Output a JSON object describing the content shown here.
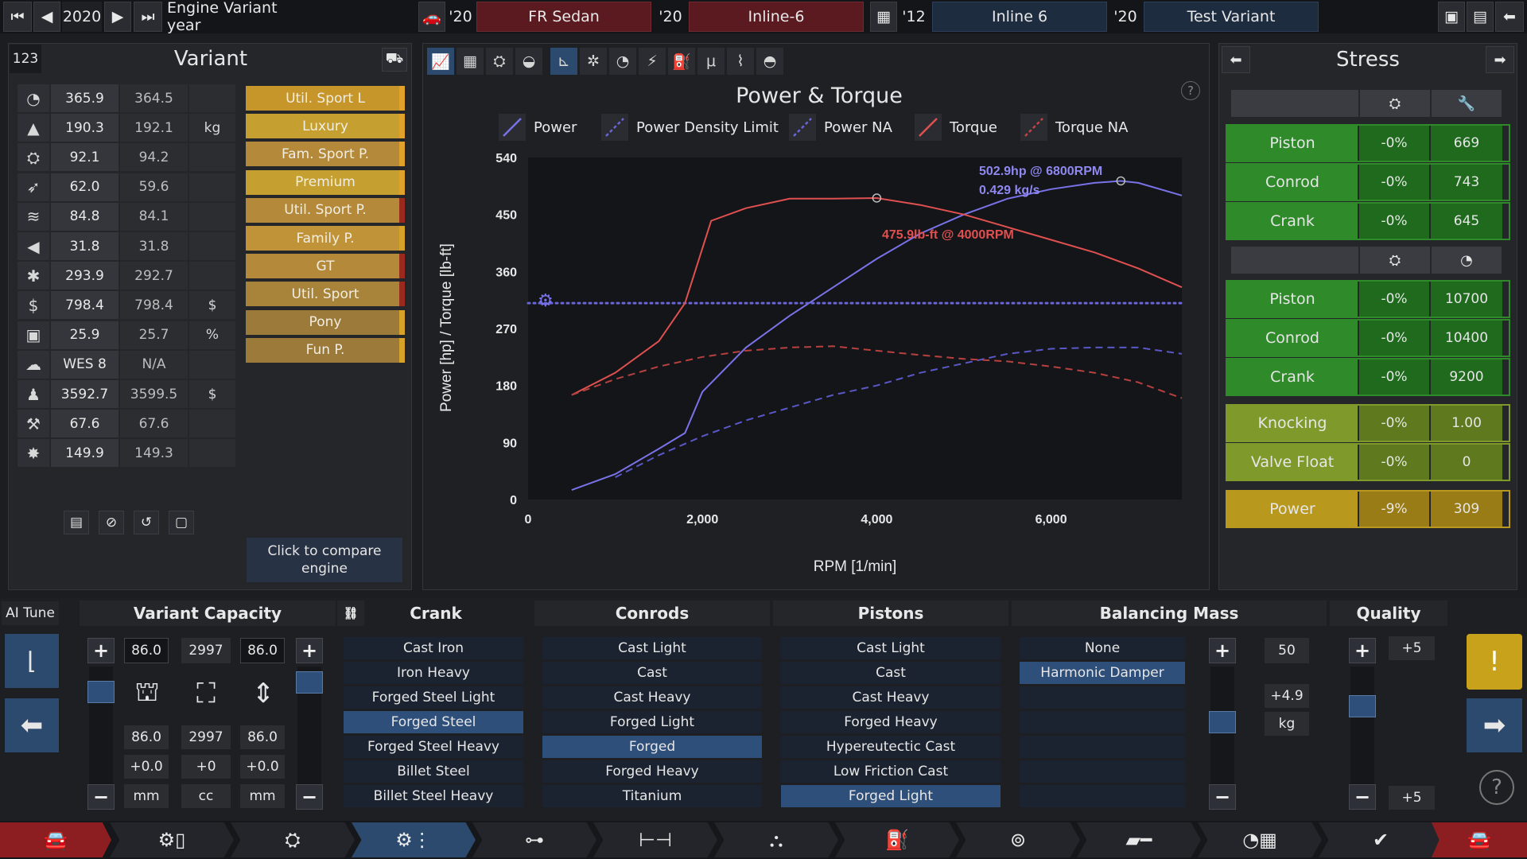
{
  "topbar": {
    "year": "2020",
    "year_label": "Engine Variant year",
    "items": [
      {
        "year": "'20",
        "label": "FR Sedan"
      },
      {
        "year": "'20",
        "label": "Inline-6"
      },
      {
        "year": "'12",
        "label": "Inline 6"
      },
      {
        "year": "'20",
        "label": "Test Variant"
      }
    ]
  },
  "variant": {
    "id": "123",
    "title": "Variant",
    "stats": [
      {
        "icon": "rpm-gauge-icon",
        "glyph": "◔",
        "v1": "365.9",
        "v2": "364.5",
        "unit": ""
      },
      {
        "icon": "weight-icon",
        "glyph": "▲",
        "v1": "190.3",
        "v2": "192.1",
        "unit": "kg"
      },
      {
        "icon": "engine-icon",
        "glyph": "⛭",
        "v1": "92.1",
        "v2": "94.2",
        "unit": ""
      },
      {
        "icon": "efficiency-icon",
        "glyph": "➶",
        "v1": "62.0",
        "v2": "59.6",
        "unit": ""
      },
      {
        "icon": "radiator-icon",
        "glyph": "≋",
        "v1": "84.8",
        "v2": "84.1",
        "unit": ""
      },
      {
        "icon": "sound-icon",
        "glyph": "◀",
        "v1": "31.8",
        "v2": "31.8",
        "unit": ""
      },
      {
        "icon": "snowflake-icon",
        "glyph": "✱",
        "v1": "293.9",
        "v2": "292.7",
        "unit": ""
      },
      {
        "icon": "cost-icon",
        "glyph": "$",
        "v1": "798.4",
        "v2": "798.4",
        "unit": "$"
      },
      {
        "icon": "fuel-can-icon",
        "glyph": "▣",
        "v1": "25.9",
        "v2": "25.7",
        "unit": "%"
      },
      {
        "icon": "emissions-icon",
        "glyph": "☁",
        "v1": "WES 8",
        "v2": "N/A",
        "unit": ""
      },
      {
        "icon": "workforce-icon",
        "glyph": "♟",
        "v1": "3592.7",
        "v2": "3599.5",
        "unit": "$"
      },
      {
        "icon": "service-icon",
        "glyph": "⚒",
        "v1": "67.6",
        "v2": "67.6",
        "unit": ""
      },
      {
        "icon": "reliability-icon",
        "glyph": "✸",
        "v1": "149.9",
        "v2": "149.3",
        "unit": ""
      }
    ],
    "categories": [
      {
        "label": "Util. Sport L",
        "bar": "#e0a22a"
      },
      {
        "label": "Luxury",
        "bar": "#e0a22a"
      },
      {
        "label": "Fam. Sport P.",
        "bar": "#e0a22a"
      },
      {
        "label": "Premium",
        "bar": "#e0a22a"
      },
      {
        "label": "Util. Sport P.",
        "bar": "#9a2a1e"
      },
      {
        "label": "Family P.",
        "bar": "#d7a228"
      },
      {
        "label": "GT",
        "bar": "#9a2a1e"
      },
      {
        "label": "Util. Sport",
        "bar": "#9a2a1e"
      },
      {
        "label": "Pony",
        "bar": "#d7a228"
      },
      {
        "label": "Fun P.",
        "bar": "#d7a228"
      }
    ],
    "compare_label": "Click to compare engine"
  },
  "chart_panel": {
    "title": "Power & Torque",
    "legend": [
      {
        "name": "Power",
        "color": "#7a72e8",
        "dash": false
      },
      {
        "name": "Power Density Limit",
        "color": "#6a66d8",
        "dash": true
      },
      {
        "name": "Power NA",
        "color": "#6a66d8",
        "dash": true
      },
      {
        "name": "Torque",
        "color": "#e05050",
        "dash": false
      },
      {
        "name": "Torque NA",
        "color": "#c04444",
        "dash": true
      }
    ],
    "annot_power_1": "502.9hp @ 6800RPM",
    "annot_power_2": "0.429 kg/s",
    "annot_torque": "475.9lb-ft @ 4000RPM"
  },
  "chart_data": {
    "type": "line",
    "xlabel": "RPM [1/min]",
    "ylabel": "Power [hp] / Torque [lb-ft]",
    "xlim": [
      0,
      7500
    ],
    "ylim": [
      0,
      540
    ],
    "xticks": [
      "0",
      "2,000",
      "4,000",
      "6,000"
    ],
    "xtick_values": [
      0,
      2000,
      4000,
      6000
    ],
    "yticks": [
      "0",
      "90",
      "180",
      "270",
      "360",
      "450",
      "540"
    ],
    "ytick_values": [
      0,
      90,
      180,
      270,
      360,
      450,
      540
    ],
    "series": [
      {
        "name": "Power",
        "x": [
          500,
          1000,
          1500,
          1800,
          2000,
          2500,
          3000,
          3500,
          4000,
          4500,
          5000,
          5500,
          6000,
          6500,
          6800,
          7000,
          7500
        ],
        "y": [
          15,
          40,
          80,
          105,
          170,
          240,
          290,
          335,
          380,
          420,
          450,
          475,
          490,
          500,
          503,
          500,
          480
        ]
      },
      {
        "name": "Power Density Limit",
        "x": [
          0,
          7500
        ],
        "y": [
          310,
          310
        ]
      },
      {
        "name": "Power NA",
        "x": [
          1000,
          1500,
          2000,
          2500,
          3000,
          3500,
          4000,
          4500,
          5000,
          5500,
          6000,
          6500,
          7000,
          7500
        ],
        "y": [
          35,
          70,
          100,
          125,
          145,
          165,
          180,
          200,
          215,
          230,
          238,
          240,
          240,
          230
        ]
      },
      {
        "name": "Torque",
        "x": [
          500,
          1000,
          1500,
          1800,
          2100,
          2500,
          3000,
          3500,
          4000,
          4500,
          5000,
          5500,
          6000,
          6500,
          7000,
          7500
        ],
        "y": [
          165,
          200,
          250,
          310,
          440,
          460,
          475,
          475,
          476,
          465,
          450,
          430,
          410,
          390,
          365,
          335
        ]
      },
      {
        "name": "Torque NA",
        "x": [
          500,
          1000,
          1500,
          2000,
          2500,
          3000,
          3500,
          4000,
          4500,
          5000,
          5500,
          6000,
          6500,
          7000,
          7500
        ],
        "y": [
          165,
          190,
          210,
          225,
          235,
          240,
          242,
          235,
          228,
          222,
          218,
          210,
          200,
          185,
          160
        ]
      }
    ],
    "markers": [
      {
        "x": 4000,
        "y": 476
      },
      {
        "x": 6800,
        "y": 503
      }
    ],
    "grid": false,
    "legend": "top"
  },
  "stress": {
    "title": "Stress",
    "group1": [
      {
        "label": "Piston",
        "pct": "-0%",
        "val": "669"
      },
      {
        "label": "Conrod",
        "pct": "-0%",
        "val": "743"
      },
      {
        "label": "Crank",
        "pct": "-0%",
        "val": "645"
      }
    ],
    "group2": [
      {
        "label": "Piston",
        "pct": "-0%",
        "val": "10700"
      },
      {
        "label": "Conrod",
        "pct": "-0%",
        "val": "10400"
      },
      {
        "label": "Crank",
        "pct": "-0%",
        "val": "9200"
      }
    ],
    "group3": [
      {
        "label": "Knocking",
        "pct": "-0%",
        "val": "1.00"
      },
      {
        "label": "Valve Float",
        "pct": "-0%",
        "val": "0"
      }
    ],
    "power": {
      "label": "Power",
      "pct": "-9%",
      "val": "309"
    },
    "colors": {
      "green": "#2f8a2a",
      "green_dark": "#1f6a1d",
      "olive": "#7f9a2a",
      "yellow": "#b9981e"
    }
  },
  "bottom": {
    "ai_tune": "AI Tune",
    "capacity": {
      "title": "Variant Capacity",
      "bore": "86.0",
      "cc": "2997",
      "stroke": "86.0",
      "bore2": "86.0",
      "cc2": "2997",
      "stroke2": "86.0",
      "bore_d": "+0.0",
      "cc_d": "+0",
      "stroke_d": "+0.0",
      "bore_u": "mm",
      "cc_u": "cc",
      "stroke_u": "mm"
    },
    "crank": {
      "title": "Crank",
      "options": [
        "Cast Iron",
        "Iron Heavy",
        "Forged Steel Light",
        "Forged Steel",
        "Forged Steel Heavy",
        "Billet Steel",
        "Billet Steel Heavy"
      ],
      "selected": 3
    },
    "conrods": {
      "title": "Conrods",
      "options": [
        "Cast Light",
        "Cast",
        "Cast Heavy",
        "Forged Light",
        "Forged",
        "Forged Heavy",
        "Titanium"
      ],
      "selected": 4
    },
    "pistons": {
      "title": "Pistons",
      "options": [
        "Cast Light",
        "Cast",
        "Cast Heavy",
        "Forged Heavy",
        "Hypereutectic Cast",
        "Low Friction Cast",
        "Forged Light"
      ],
      "selected": 6
    },
    "balancing": {
      "title": "Balancing Mass",
      "options": [
        "None",
        "Harmonic Damper"
      ],
      "selected": 1,
      "value": "50",
      "delta": "+4.9",
      "unit": "kg"
    },
    "quality": {
      "title": "Quality",
      "top": "+5",
      "bottom": "+5"
    }
  }
}
